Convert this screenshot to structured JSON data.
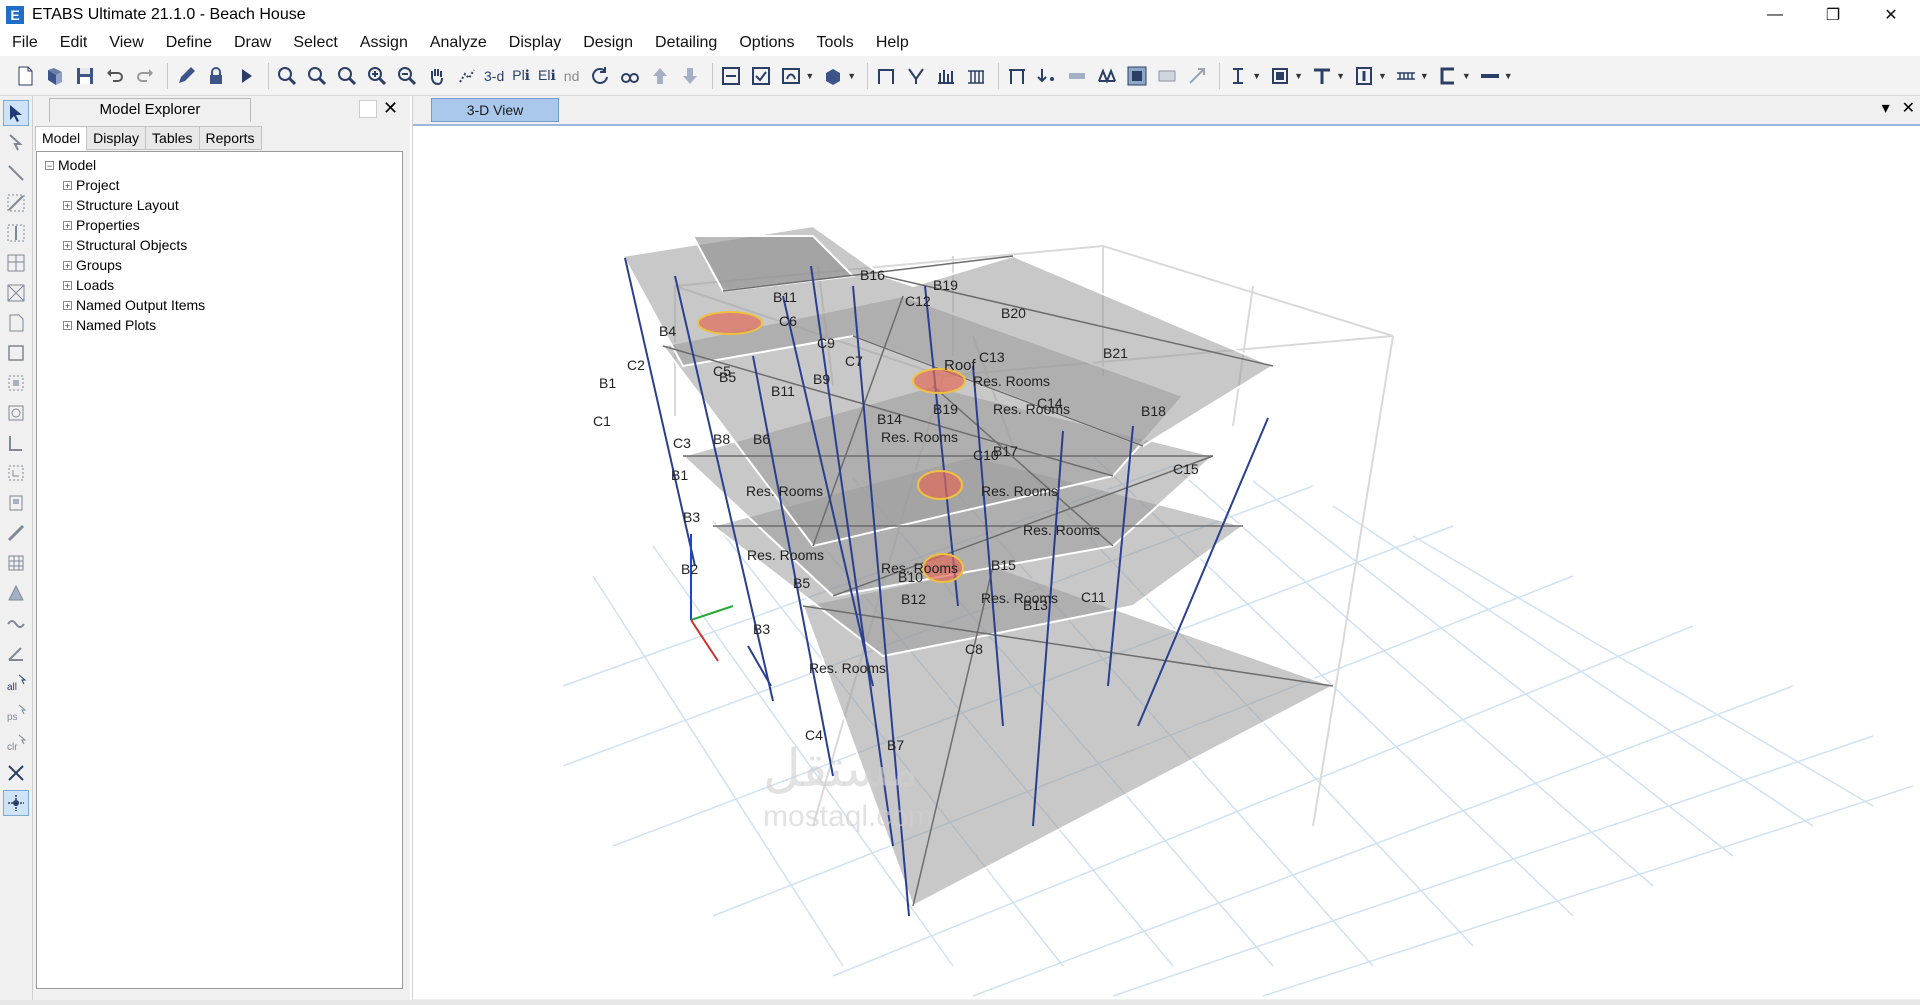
{
  "window": {
    "title": "ETABS Ultimate 21.1.0 - Beach House",
    "app_icon": "E",
    "controls": {
      "minimize": "—",
      "restore": "❐",
      "close": "✕"
    }
  },
  "menu": [
    "File",
    "Edit",
    "View",
    "Define",
    "Draw",
    "Select",
    "Assign",
    "Analyze",
    "Display",
    "Design",
    "Detailing",
    "Options",
    "Tools",
    "Help"
  ],
  "toolbar": {
    "view_3d": "3-d",
    "view_plan": "Plℹ",
    "view_elev": "Elℹ",
    "view_nd": "nd"
  },
  "explorer": {
    "title": "Model Explorer",
    "close": "✕",
    "tabs": [
      "Model",
      "Display",
      "Tables",
      "Reports"
    ],
    "root": "Model",
    "items": [
      "Project",
      "Structure Layout",
      "Properties",
      "Structural Objects",
      "Groups",
      "Loads",
      "Named Output Items",
      "Named Plots"
    ]
  },
  "view": {
    "tab_label": "3-D View",
    "dropdown": "▾",
    "close": "✕",
    "labels": {
      "roof": "Roof",
      "room": "Res. Rooms",
      "c1": "C1",
      "c2": "C2",
      "c3": "C3",
      "c4": "C4",
      "c5": "C5",
      "c6": "C6",
      "c7": "C7",
      "c8": "C8",
      "c9": "C9",
      "c10": "C10",
      "c11": "C11",
      "c12": "C12",
      "c13": "C13",
      "c14": "C14",
      "c15": "C15",
      "b1": "B1",
      "b2": "B2",
      "b3": "B3",
      "b4": "B4",
      "b5": "B5",
      "b6": "B6",
      "b7": "B7",
      "b8": "B8",
      "b9": "B9",
      "b10": "B10",
      "b11": "B11",
      "b12": "B12",
      "b13": "B13",
      "b14": "B14",
      "b15": "B15",
      "b16": "B16",
      "b17": "B17",
      "b18": "B18",
      "b19": "B19",
      "b20": "B20",
      "b21": "B21",
      "watermark_ar": "مستقل",
      "watermark_en": "mostaql.com"
    }
  },
  "colors": {
    "slab": "#9a9a9a",
    "column": "#2a3f8f",
    "grid": "#cfe2f3",
    "opening": "#e06a5a",
    "view_tab": "#a9c8ec"
  }
}
